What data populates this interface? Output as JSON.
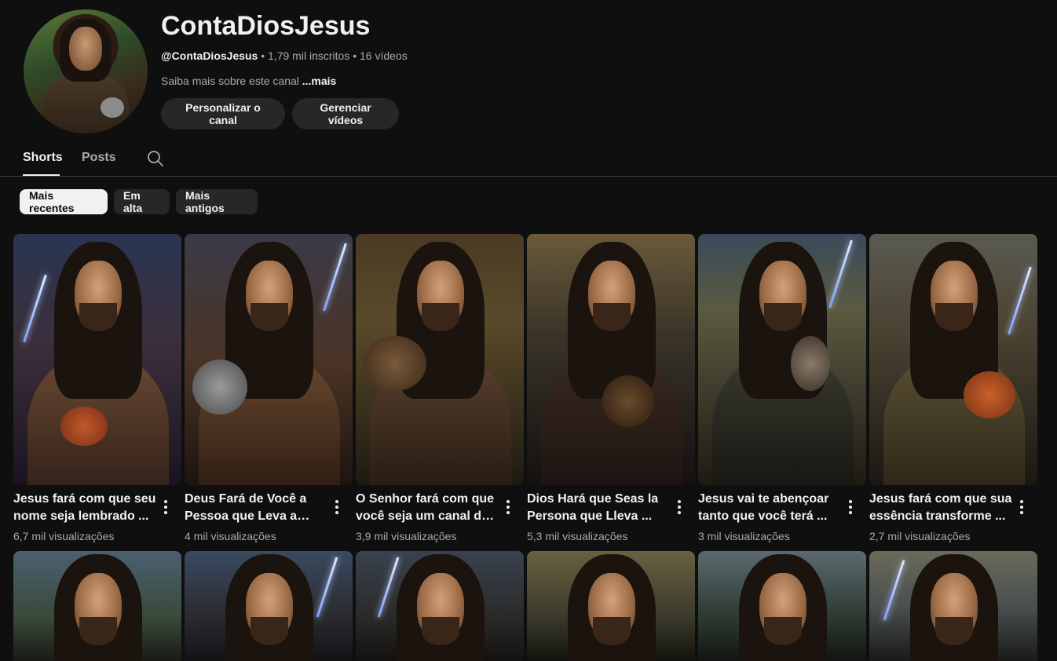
{
  "channel": {
    "name": "ContaDiosJesus",
    "handle": "@ContaDiosJesus",
    "subscribers": "1,79 mil inscritos",
    "videos": "16 vídeos",
    "separator": "•",
    "about": "Saiba mais sobre este canal",
    "about_more": "...mais",
    "customize_label": "Personalizar o canal",
    "manage_label": "Gerenciar vídeos"
  },
  "tabs": [
    {
      "label": "Shorts",
      "active": true
    },
    {
      "label": "Posts",
      "active": false
    }
  ],
  "search_icon": "search-icon",
  "filters": [
    {
      "label": "Mais recentes",
      "selected": true
    },
    {
      "label": "Em alta",
      "selected": false
    },
    {
      "label": "Mais antigos",
      "selected": false
    }
  ],
  "shorts": [
    {
      "title": "Jesus fará com que seu nome seja lembrado ...",
      "views": "6,7 mil visualizações"
    },
    {
      "title": "Deus Fará de Você a Pessoa que Leva a Sua...",
      "views": "4 mil visualizações"
    },
    {
      "title": "O Senhor fará com que você seja um canal de ...",
      "views": "3,9 mil visualizações"
    },
    {
      "title": "Dios Hará que Seas la Persona que Lleva ...",
      "views": "5,3 mil visualizações"
    },
    {
      "title": "Jesus vai te abençoar tanto que você terá ...",
      "views": "3 mil visualizações"
    },
    {
      "title": "Jesus fará com que sua essência transforme ...",
      "views": "2,7 mil visualizações"
    }
  ],
  "colors": {
    "background": "#0f0f0f",
    "text_primary": "#f1f1f1",
    "text_secondary": "#aaaaaa",
    "button_bg": "#272727",
    "chip_selected_bg": "#f1f1f1"
  }
}
